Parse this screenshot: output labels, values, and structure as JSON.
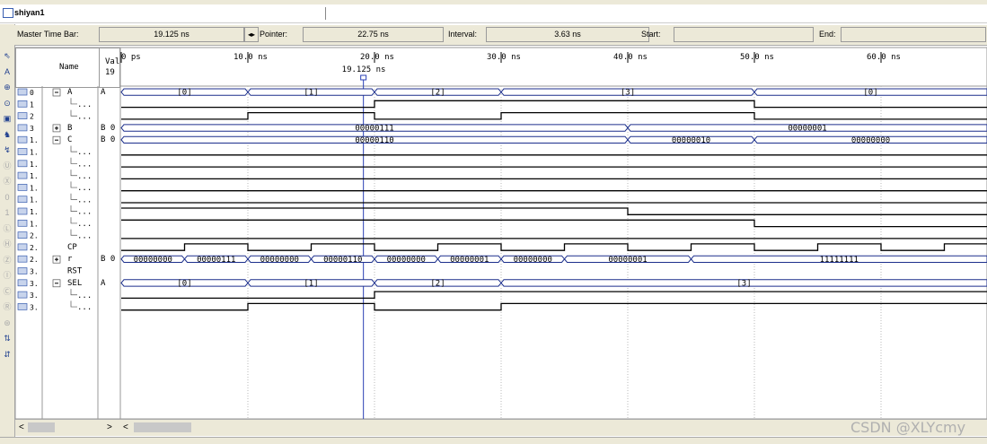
{
  "window": {
    "title": "shiyan1"
  },
  "measure_bar": {
    "master_time_bar_label": "Master Time Bar:",
    "master_time_value": "19.125 ns",
    "pointer_label": "Pointer:",
    "pointer_value": "22.75 ns",
    "interval_label": "Interval:",
    "interval_value": "3.63 ns",
    "start_label": "Start:",
    "start_value": "",
    "end_label": "End:",
    "end_value": ""
  },
  "headers": {
    "name": "Name",
    "value": "Val",
    "value_sub": "19"
  },
  "timeline": {
    "ticks": [
      "0 ps",
      "10.0 ns",
      "20.0 ns",
      "30.0 ns",
      "40.0 ns",
      "50.0 ns",
      "60.0 ns"
    ],
    "cursor_label": "19.125 ns",
    "cursor_time_ns": 19.125,
    "time_span_ns": [
      0,
      68.9
    ]
  },
  "signals": [
    {
      "idx": "0",
      "expand": "minus",
      "name": "A",
      "value": "A",
      "kind": "bus",
      "transitions": [
        0,
        10,
        20,
        30,
        50
      ],
      "labels": [
        "[0]",
        "[1]",
        "[2]",
        "[3]",
        "[0]"
      ]
    },
    {
      "idx": "1",
      "expand": "",
      "name": "...",
      "value": "",
      "kind": "bit",
      "init": 0,
      "transitions": [
        20,
        50
      ]
    },
    {
      "idx": "2",
      "expand": "",
      "name": "...",
      "value": "",
      "kind": "bit",
      "init": 0,
      "transitions": [
        10,
        20,
        30,
        50
      ]
    },
    {
      "idx": "3",
      "expand": "plus",
      "name": "B",
      "value": "B 0",
      "kind": "bus",
      "transitions": [
        0,
        40
      ],
      "labels": [
        "00000111",
        "00000001"
      ]
    },
    {
      "idx": "1.",
      "expand": "minus",
      "name": "C",
      "value": "B 0",
      "kind": "bus",
      "transitions": [
        0,
        40,
        50
      ],
      "labels": [
        "00000110",
        "00000010",
        "00000000"
      ]
    },
    {
      "idx": "1.",
      "expand": "",
      "name": "...",
      "value": "",
      "kind": "bit",
      "init": 0,
      "transitions": []
    },
    {
      "idx": "1.",
      "expand": "",
      "name": "...",
      "value": "",
      "kind": "bit",
      "init": 0,
      "transitions": []
    },
    {
      "idx": "1.",
      "expand": "",
      "name": "...",
      "value": "",
      "kind": "bit",
      "init": 0,
      "transitions": []
    },
    {
      "idx": "1.",
      "expand": "",
      "name": "...",
      "value": "",
      "kind": "bit",
      "init": 0,
      "transitions": []
    },
    {
      "idx": "1.",
      "expand": "",
      "name": "...",
      "value": "",
      "kind": "bit",
      "init": 0,
      "transitions": []
    },
    {
      "idx": "1.",
      "expand": "",
      "name": "...",
      "value": "",
      "kind": "bit",
      "init": 1,
      "transitions": [
        40
      ]
    },
    {
      "idx": "1.",
      "expand": "",
      "name": "...",
      "value": "",
      "kind": "bit",
      "init": 1,
      "transitions": [
        50
      ]
    },
    {
      "idx": "2.",
      "expand": "",
      "name": "...",
      "value": "",
      "kind": "bit",
      "init": 0,
      "transitions": []
    },
    {
      "idx": "2.",
      "expand": "",
      "name": "CP",
      "value": "",
      "kind": "bit",
      "init": 0,
      "transitions": [
        5,
        10,
        15,
        20,
        25,
        30,
        35,
        40,
        45,
        50,
        55,
        60,
        65
      ]
    },
    {
      "idx": "2.",
      "expand": "plus",
      "name": "r",
      "value": "B 0",
      "kind": "bus",
      "transitions": [
        0,
        5,
        10,
        15,
        20,
        25,
        30,
        35,
        45
      ],
      "labels": [
        "00000000",
        "00000111",
        "00000000",
        "00000110",
        "00000000",
        "00000001",
        "00000000",
        "00000001",
        "11111111"
      ]
    },
    {
      "idx": "3.",
      "expand": "",
      "name": "RST",
      "value": "",
      "kind": "none"
    },
    {
      "idx": "3.",
      "expand": "minus",
      "name": "SEL",
      "value": "A",
      "kind": "bus",
      "transitions": [
        0,
        10,
        20,
        30
      ],
      "labels": [
        "[0]",
        "[1]",
        "[2]",
        "[3]"
      ]
    },
    {
      "idx": "3.",
      "expand": "",
      "name": "...",
      "value": "",
      "kind": "bit",
      "init": 0,
      "transitions": [
        20
      ]
    },
    {
      "idx": "3.",
      "expand": "",
      "name": "...",
      "value": "",
      "kind": "bit",
      "init": 0,
      "transitions": [
        10,
        20,
        30
      ]
    }
  ],
  "toolbar_icons": [
    "pointer-icon",
    "text-tool-icon",
    "node-finder-icon",
    "zoom-icon",
    "full-screen-icon",
    "find-icon",
    "replace-icon",
    "uninitialized-icon",
    "forcing-low-icon",
    "forcing-high-icon",
    "weak-low-icon",
    "weak-high-icon",
    "high-impedance-icon",
    "invert-icon",
    "count-value-icon",
    "clock-icon",
    "arbitrary-value-icon",
    "random-value-icon",
    "sort-icon",
    "group-icon"
  ],
  "watermark": "CSDN @XLYcmy",
  "colors": {
    "bus": "#1c2f8c",
    "cursor": "#2a3fb4",
    "grid": "#b8b8b8",
    "panel": "#ece9d8"
  }
}
